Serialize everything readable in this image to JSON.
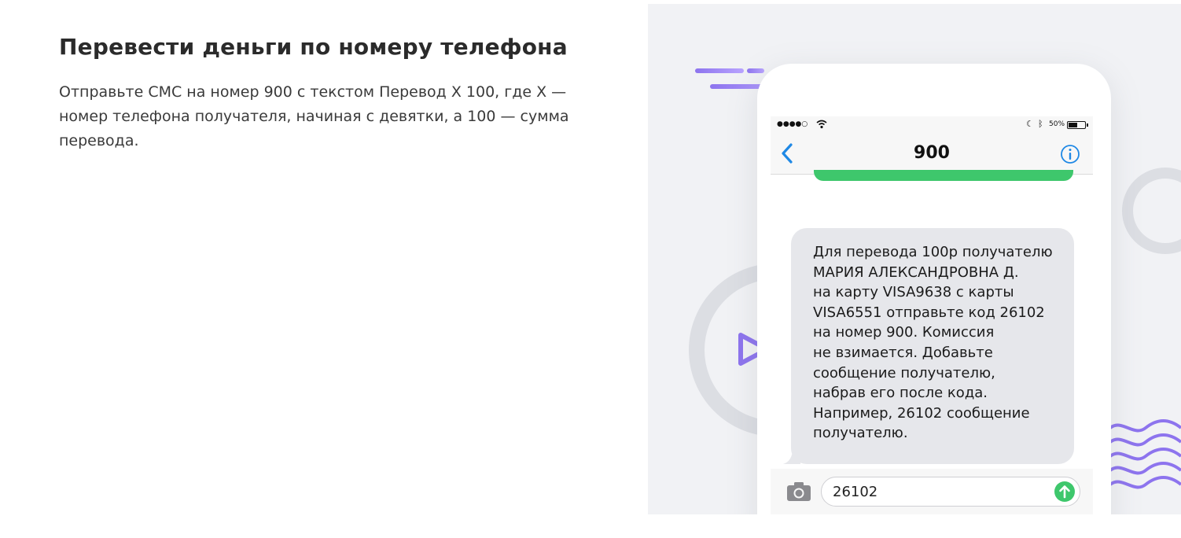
{
  "heading": {
    "title": "Перевести деньги по номеру телефона",
    "description": "Отправьте СМС на номер 900 с текстом Перевод Х 100, где Х — номер телефона получателя, начиная с девятки, а 100 — сумма перевода."
  },
  "phone": {
    "status_bar": {
      "signal": "●●●●○",
      "battery_label": "50%",
      "icons": [
        "wifi-icon",
        "moon-icon",
        "bluetooth-icon",
        "battery-icon"
      ]
    },
    "nav": {
      "title": "900",
      "back_icon": "chevron-left-icon",
      "info_icon": "info-icon"
    },
    "incoming_message": "Для перевода 100р получателю\nМАРИЯ АЛЕКСАНДРОВНА Д.\nна карту VISA9638 с карты\nVISA6551 отправьте код 26102\nна номер 900. Комиссия\nне взимается. Добавьте\nсообщение получателю,\nнабрав его после кода.\nНапример, 26102 сообщение\nполучателю.",
    "composer": {
      "input_value": "26102",
      "camera_icon": "camera-icon",
      "send_icon": "send-arrow-icon"
    }
  },
  "colors": {
    "accent_ios_blue": "#1e88e5",
    "sms_green": "#3ec76c",
    "deco_purple": "#8d74ee",
    "bubble_gray": "#e6e7eb",
    "illustration_bg": "#f1f2f5"
  }
}
